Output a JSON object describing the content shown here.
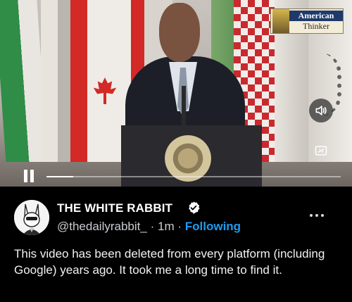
{
  "video": {
    "watermark": {
      "line1": "American",
      "line2": "Thinker"
    },
    "volume_icon": "speaker-icon",
    "gif_icon": "gif-icon",
    "playback_state": "pause-icon",
    "progress_fraction": 0.09
  },
  "post": {
    "author_name": "THE WHITE RABBIT",
    "verified_icon": "verified-badge-icon",
    "handle": "@thedailyrabbit_",
    "separator": "·",
    "time": "1m",
    "separator2": "·",
    "follow_label": "Following",
    "more_icon": "more-horizontal-icon",
    "text": "This video has been deleted from every platform (including Google) years ago. It took me a long time to find it."
  },
  "colors": {
    "accent": "#1d9bf0",
    "background": "#000000",
    "text": "#e7e9ea"
  }
}
